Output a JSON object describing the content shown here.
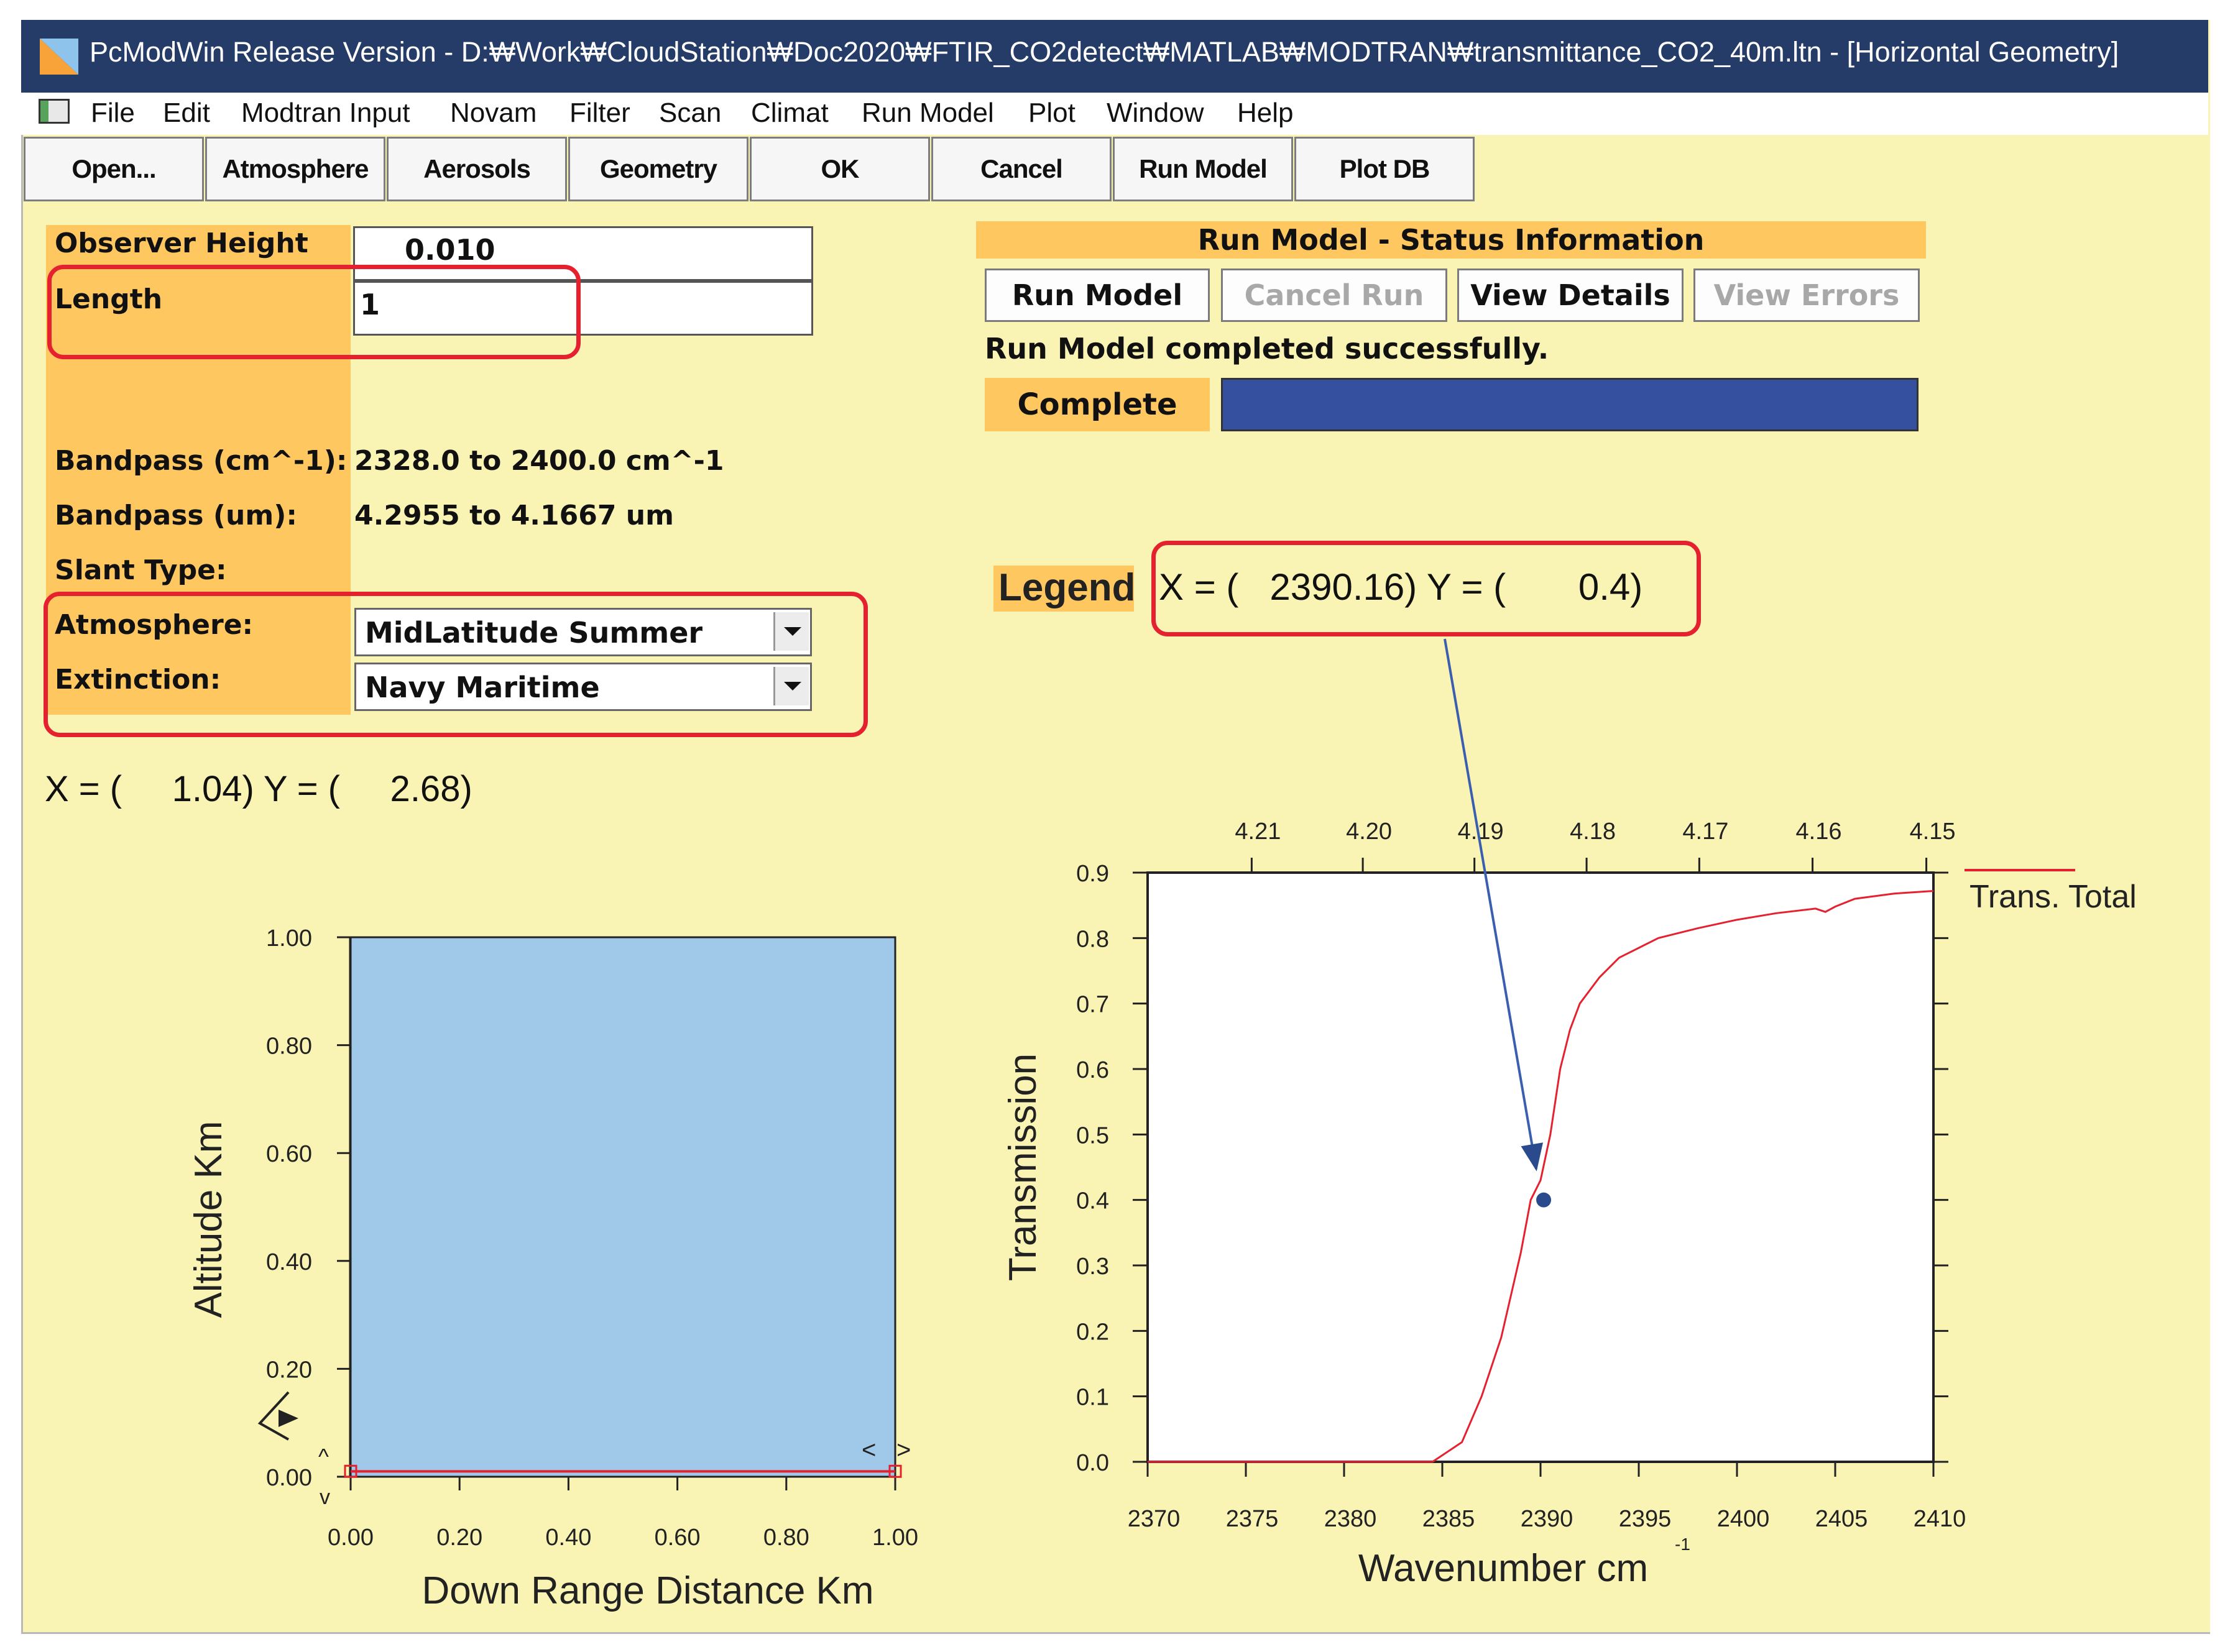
{
  "window": {
    "title": "PcModWin Release Version - D:₩Work₩CloudStation₩Doc2020₩FTIR_CO2detect₩MATLAB₩MODTRAN₩transmittance_CO2_40m.ltn - [Horizontal Geometry]"
  },
  "menu": [
    "File",
    "Edit",
    "Modtran Input",
    "Novam",
    "Filter",
    "Scan",
    "Climat",
    "Run Model",
    "Plot",
    "Window",
    "Help"
  ],
  "toolbar": [
    "Open...",
    "Atmosphere",
    "Aerosols",
    "Geometry",
    "OK",
    "Cancel",
    "Run Model",
    "Plot DB"
  ],
  "form": {
    "observer_height_label": "Observer Height",
    "observer_height_value": "0.010",
    "length_label": "Length",
    "length_value": "1",
    "bandpass_cm_label": "Bandpass (cm^-1):",
    "bandpass_cm_value": "2328.0 to 2400.0 cm^-1",
    "bandpass_um_label": "Bandpass (um):",
    "bandpass_um_value": "4.2955 to 4.1667 um",
    "slant_type_label": "Slant Type:",
    "atmosphere_label": "Atmosphere:",
    "atmosphere_value": "MidLatitude Summer",
    "extinction_label": "Extinction:",
    "extinction_value": "Navy Maritime"
  },
  "status": {
    "header": "Run Model - Status Information",
    "buttons": [
      "Run Model",
      "Cancel Run",
      "View Details",
      "View Errors"
    ],
    "message": "Run Model completed successfully.",
    "progress_label": "Complete",
    "progress_fraction": 1.0,
    "progress_color": "#3650a0"
  },
  "geometry_readout": "X = (     1.04) Y = (     2.68)",
  "legend": {
    "label": "Legend",
    "readout": "X = (   2390.16) Y = (       0.4)"
  },
  "chart_data": [
    {
      "type": "area",
      "xlabel": "Down Range Distance Km",
      "ylabel": "Altitude Km",
      "x_ticks": [
        "0.00",
        "0.20",
        "0.40",
        "0.60",
        "0.80",
        "1.00"
      ],
      "y_ticks": [
        "0.00",
        "0.20",
        "0.40",
        "0.60",
        "0.80",
        "1.00"
      ],
      "xlim": [
        0,
        1
      ],
      "ylim": [
        0,
        1
      ],
      "fill_color": "#a0c8e8",
      "path": {
        "x": [
          0,
          1
        ],
        "y": [
          0.01,
          0.01
        ],
        "color": "#e52130"
      }
    },
    {
      "type": "line",
      "xlabel": "Wavenumber cm",
      "xlabel_superscript": "-1",
      "ylabel": "Transmission",
      "xlim": [
        2370,
        2410
      ],
      "ylim": [
        0,
        0.9
      ],
      "x_ticks": [
        "2370",
        "2375",
        "2380",
        "2385",
        "2390",
        "2395",
        "2400",
        "2405",
        "2410"
      ],
      "y_ticks": [
        "0.0",
        "0.1",
        "0.2",
        "0.3",
        "0.4",
        "0.5",
        "0.6",
        "0.7",
        "0.8",
        "0.9"
      ],
      "top_axis_ticks": [
        "4.21",
        "4.20",
        "4.19",
        "4.18",
        "4.17",
        "4.16",
        "4.15"
      ],
      "series": [
        {
          "name": "Trans. Total",
          "color": "#e52130",
          "x": [
            2370,
            2375,
            2380,
            2384.5,
            2385,
            2386,
            2387,
            2388,
            2389,
            2389.5,
            2390,
            2390.5,
            2391,
            2391.5,
            2392,
            2393,
            2394,
            2395,
            2396,
            2398,
            2400,
            2402,
            2404,
            2404.5,
            2405,
            2406,
            2408,
            2410
          ],
          "y": [
            0.0,
            0.0,
            0.0,
            0.0,
            0.01,
            0.03,
            0.1,
            0.19,
            0.32,
            0.4,
            0.43,
            0.5,
            0.6,
            0.66,
            0.7,
            0.74,
            0.77,
            0.785,
            0.8,
            0.815,
            0.828,
            0.838,
            0.845,
            0.84,
            0.848,
            0.86,
            0.868,
            0.872
          ]
        }
      ],
      "highlight_point": {
        "x": 2390.16,
        "y": 0.4,
        "color": "#2a4a8e"
      }
    }
  ]
}
